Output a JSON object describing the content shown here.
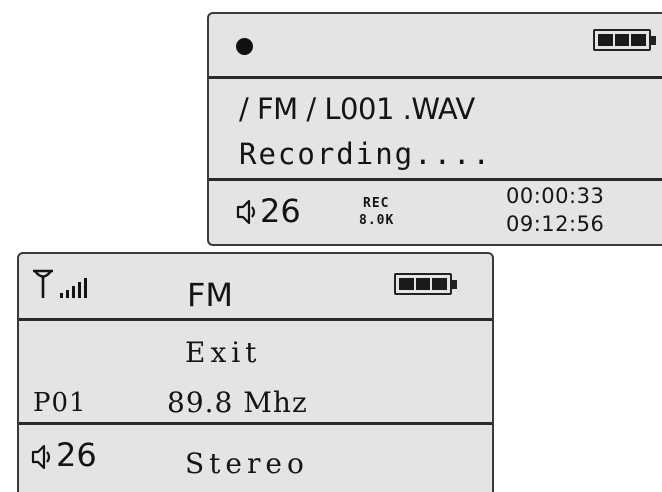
{
  "recording_screen": {
    "status_icon": "record-dot-icon",
    "battery_icon": "battery-full-icon",
    "path": "/ FM / L001 .WAV",
    "status": "Recording....",
    "speaker_icon": "speaker-icon",
    "volume": "26",
    "format_label": "REC",
    "bitrate": "8.0K",
    "elapsed": "00:00:33",
    "remaining": "09:12:56"
  },
  "fm_screen": {
    "signal_icon": "antenna-signal-icon",
    "title": "FM",
    "battery_icon": "battery-full-icon",
    "menu_item": "Exit",
    "preset": "P01",
    "frequency": "89.8 Mhz",
    "speaker_icon": "speaker-icon",
    "volume": "26",
    "audio_mode": "Stereo"
  }
}
